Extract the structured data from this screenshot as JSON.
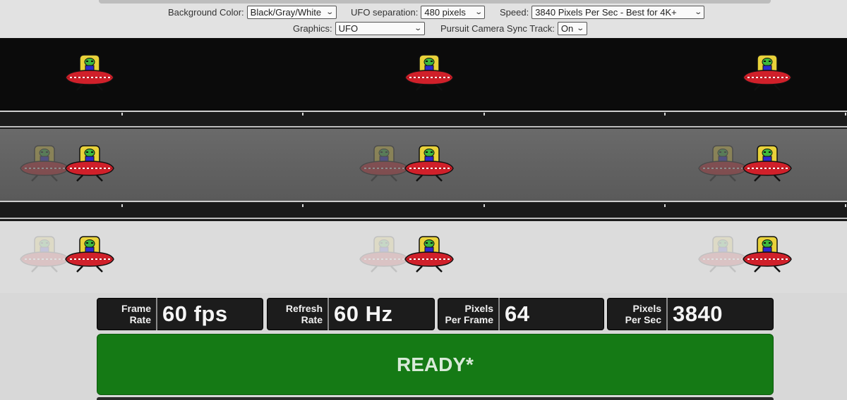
{
  "controls": {
    "background_color": {
      "label": "Background Color:",
      "value": "Black/Gray/White"
    },
    "ufo_separation": {
      "label": "UFO separation:",
      "value": "480 pixels"
    },
    "speed": {
      "label": "Speed:",
      "value": "3840 Pixels Per Sec - Best for 4K+"
    },
    "graphics": {
      "label": "Graphics:",
      "value": "UFO"
    },
    "pursuit_sync": {
      "label": "Pursuit Camera Sync Track:",
      "value": "On"
    }
  },
  "stats": {
    "frame_rate": {
      "label_line1": "Frame",
      "label_line2": "Rate",
      "value": "60 fps"
    },
    "refresh_rate": {
      "label_line1": "Refresh",
      "label_line2": "Rate",
      "value": "60 Hz"
    },
    "pixels_per_frame": {
      "label_line1": "Pixels",
      "label_line2": "Per Frame",
      "value": "64"
    },
    "pixels_per_sec": {
      "label_line1": "Pixels",
      "label_line2": "Per Sec",
      "value": "3840"
    }
  },
  "status": {
    "text": "READY*"
  },
  "colors": {
    "ready_green": "#157a15",
    "ufo_body": "#d0202a",
    "alien_green": "#3db83d",
    "dome_yellow": "#e8d23a"
  }
}
